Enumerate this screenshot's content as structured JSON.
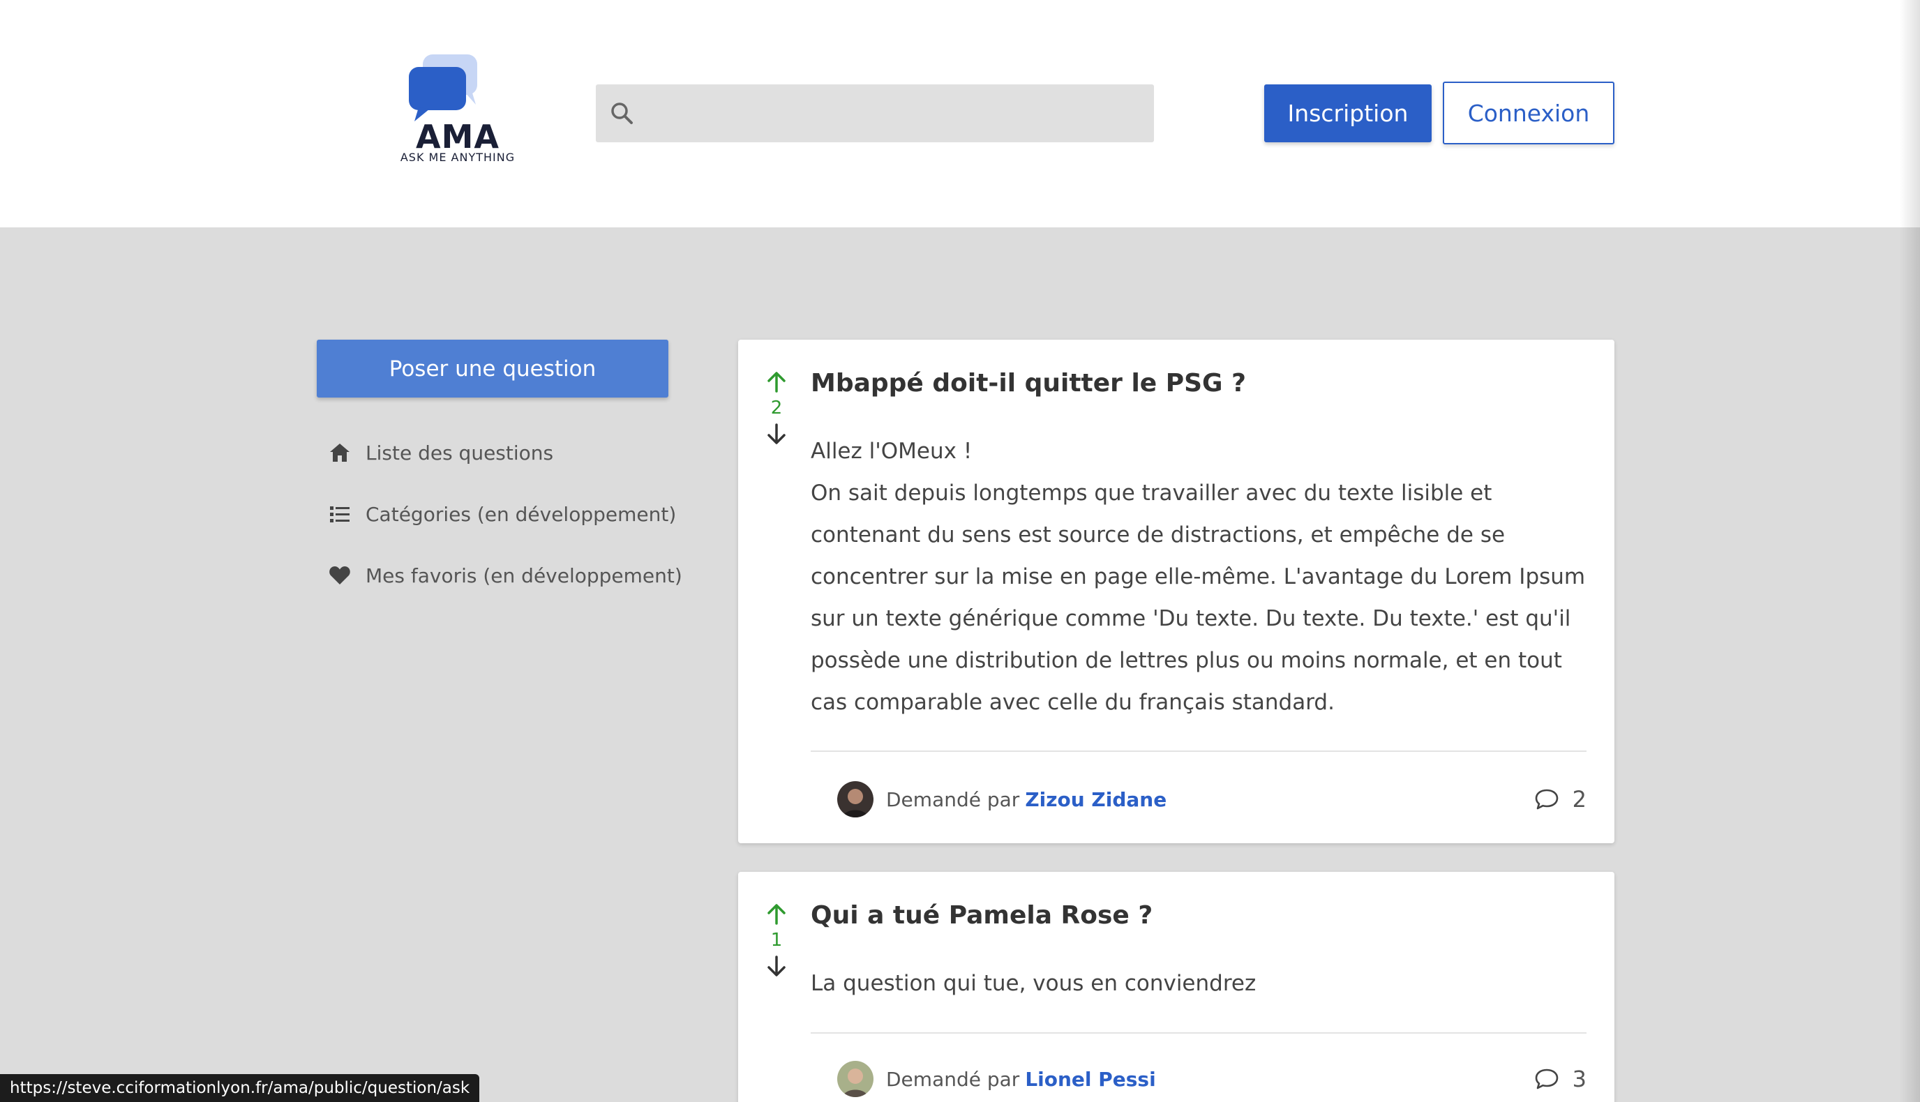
{
  "header": {
    "logo_title": "AMA",
    "logo_subtitle": "ASK ME ANYTHING",
    "search": {
      "placeholder": "",
      "value": ""
    },
    "register_label": "Inscription",
    "login_label": "Connexion"
  },
  "sidebar": {
    "ask_label": "Poser une question",
    "items": [
      {
        "label": "Liste des questions",
        "icon": "home-icon"
      },
      {
        "label": "Catégories (en développement)",
        "icon": "list-icon"
      },
      {
        "label": "Mes favoris (en développement)",
        "icon": "heart-icon"
      }
    ]
  },
  "questions": [
    {
      "title": "Mbappé doit-il quitter le PSG ?",
      "votes": "2",
      "body_lines": [
        "Allez l'OMeux !",
        "On sait depuis longtemps que travailler avec du texte lisible et contenant du sens est source de distractions, et empêche de se concentrer sur la mise en page elle-même. L'avantage du Lorem Ipsum sur un texte générique comme 'Du texte. Du texte. Du texte.' est qu'il possède une distribution de lettres plus ou moins normale, et en tout cas comparable avec celle du français standard."
      ],
      "asked_by_label": "Demandé par",
      "author": "Zizou Zidane",
      "comments": "2"
    },
    {
      "title": "Qui a tué Pamela Rose ?",
      "votes": "1",
      "body_lines": [
        "La question qui tue, vous en conviendrez"
      ],
      "asked_by_label": "Demandé par",
      "author": "Lionel Pessi",
      "comments": "3"
    }
  ],
  "status_bar": {
    "url": "https://steve.cciformationlyon.fr/ama/public/question/ask"
  },
  "colors": {
    "primary": "#2b5fc7",
    "ask_button": "#4f7fd3",
    "upvote": "#2f9a2f",
    "background": "#dcdcdc"
  }
}
